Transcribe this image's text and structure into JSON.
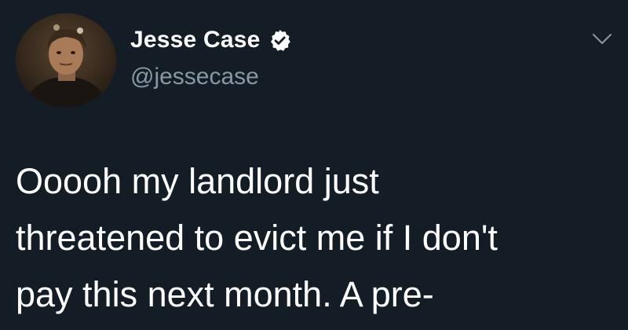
{
  "author": {
    "display_name": "Jesse Case",
    "handle": "@jessecase",
    "verified": true,
    "verified_color": "#ffffff",
    "avatar_icon": "profile-photo"
  },
  "menu": {
    "icon": "chevron-down-icon"
  },
  "tweet": {
    "lines": [
      "Ooooh my landlord just",
      "threatened to evict me if I don't",
      "pay this next month. A pre-"
    ]
  },
  "colors": {
    "background": "#141d26",
    "primary_text": "#ffffff",
    "secondary_text": "#8899a6"
  }
}
